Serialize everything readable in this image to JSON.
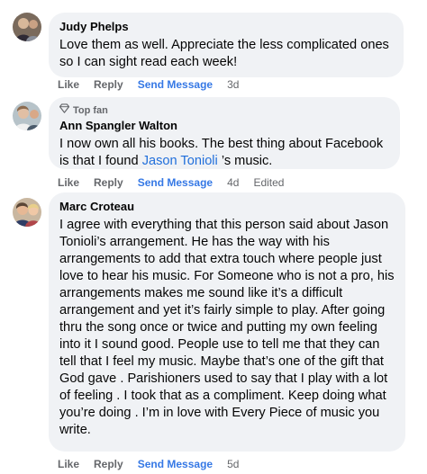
{
  "comments": [
    {
      "author": "Judy Phelps",
      "text": "Love them as well. Appreciate the less complicated ones so I can sight read each week!",
      "actions": {
        "like": "Like",
        "reply": "Reply",
        "send_message": "Send Message",
        "time": "3d"
      }
    },
    {
      "badge": "Top fan",
      "author": "Ann Spangler Walton",
      "text_before": "I now own all his books. The best thing about Facebook is that I found ",
      "mention": "Jason Tonioli",
      "text_after": " ’s music.",
      "actions": {
        "like": "Like",
        "reply": "Reply",
        "send_message": "Send Message",
        "time": "4d",
        "edited": "Edited"
      }
    },
    {
      "author": "Marc Croteau",
      "text": "I agree with everything that this person said about Jason Tonioli’s arrangement. He has the way with his arrangements to add that extra touch where people just love to hear his music. For Someone who is not a pro, his arrangements makes me sound like it’s a difficult arrangement and yet it’s fairly simple to play. After going thru the song once or twice and putting my own feeling into it I sound good. People use to tell me that they can tell that I feel my music. Maybe that’s one of the gift that God gave . Parishioners used to say that I play with a lot of feeling . I took that as a compliment. Keep doing what you’re doing . I’m in love with Every Piece of music you write.",
      "actions": {
        "like": "Like",
        "reply": "Reply",
        "send_message": "Send Message",
        "time": "5d"
      }
    }
  ],
  "colors": {
    "bubble": "#f0f2f5",
    "link": "#3578e5",
    "mention": "#216fdb",
    "muted": "#65676b"
  }
}
